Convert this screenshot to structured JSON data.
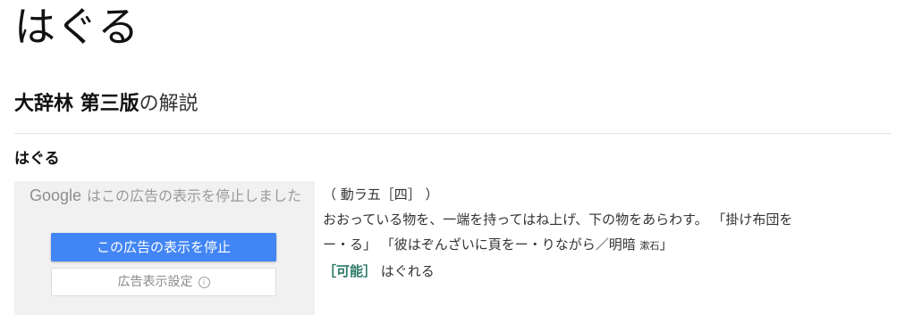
{
  "headword": "はぐる",
  "dictionary": {
    "name": "大辞林 第三版",
    "suffix": "の解説"
  },
  "entry": {
    "title": "はぐる",
    "pos": "（ 動ラ五［四］ ）",
    "definition_line1": "おおっている物を、一端を持ってはね上げ、下の物をあらわす。 「掛け布団を",
    "definition_line2_a": "ー・る」 「彼はぞんざいに頁をー・りながら／明暗 ",
    "definition_author": "漱石",
    "definition_line2_b": "」",
    "potential_label": "［可能］",
    "potential_form": " はぐれる"
  },
  "ad": {
    "google_logo": "Google",
    "message": "はこの広告の表示を停止しました",
    "stop_button": "この広告の表示を停止",
    "settings_button": "広告表示設定",
    "info_glyph": "i",
    "accent_color": "#4285f4"
  }
}
